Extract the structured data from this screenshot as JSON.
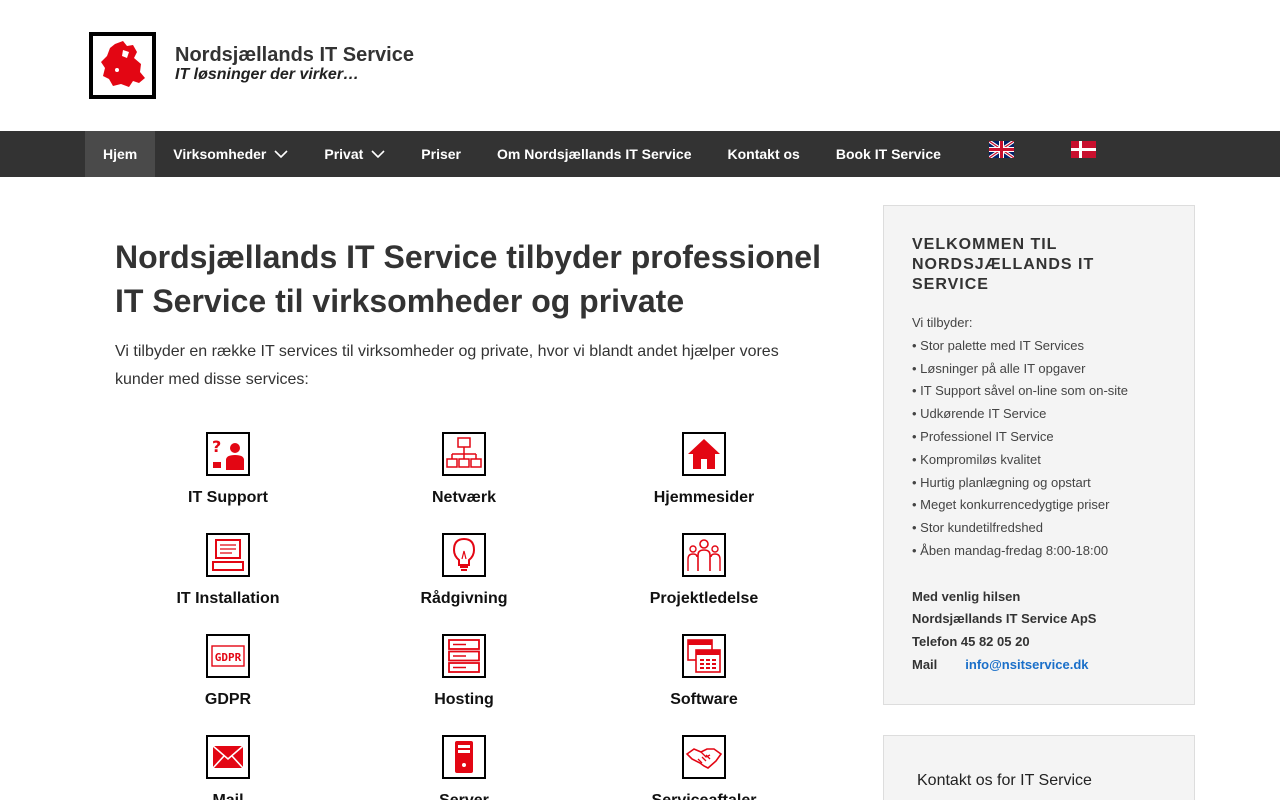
{
  "header": {
    "title": "Nordsjællands IT Service",
    "tagline": "IT løsninger der virker…"
  },
  "nav": {
    "items": [
      {
        "label": "Hjem",
        "active": true,
        "dropdown": false
      },
      {
        "label": "Virksomheder",
        "active": false,
        "dropdown": true
      },
      {
        "label": "Privat",
        "active": false,
        "dropdown": true
      },
      {
        "label": "Priser",
        "active": false,
        "dropdown": false
      },
      {
        "label": "Om Nordsjællands IT Service",
        "active": false,
        "dropdown": false
      },
      {
        "label": "Kontakt os",
        "active": false,
        "dropdown": false
      },
      {
        "label": "Book IT Service",
        "active": false,
        "dropdown": false
      }
    ],
    "flags": [
      "uk-flag-icon",
      "danish-flag-icon"
    ]
  },
  "main": {
    "title": "Nordsjællands IT Service tilbyder professionel IT Service til virksomheder og private",
    "intro": "Vi tilbyder en række IT services til virksomheder og private, hvor vi blandt andet hjælper vores kunder med disse services:"
  },
  "services": [
    {
      "label": "IT Support",
      "icon": "support-person-icon"
    },
    {
      "label": "Netværk",
      "icon": "network-icon"
    },
    {
      "label": "Hjemmesider",
      "icon": "house-icon"
    },
    {
      "label": "IT Installation",
      "icon": "computer-icon"
    },
    {
      "label": "Rådgivning",
      "icon": "lightbulb-icon"
    },
    {
      "label": "Projektledelse",
      "icon": "team-icon"
    },
    {
      "label": "GDPR",
      "icon": "gdpr-icon"
    },
    {
      "label": "Hosting",
      "icon": "server-rack-icon"
    },
    {
      "label": "Software",
      "icon": "software-window-icon"
    },
    {
      "label": "Mail",
      "icon": "mail-icon"
    },
    {
      "label": "Server",
      "icon": "server-tower-icon"
    },
    {
      "label": "Serviceaftaler",
      "icon": "handshake-icon"
    }
  ],
  "sidebar": {
    "title": "VELKOMMEN TIL NORDSJÆLLANDS IT SERVICE",
    "intro": "Vi tilbyder:",
    "list": [
      "• Stor palette med IT Services",
      "• Løsninger på alle IT opgaver",
      "• IT Support såvel on-line som on-site",
      "• Udkørende IT Service",
      "• Professionel IT Service",
      "• Kompromiløs kvalitet",
      "• Hurtig planlægning og opstart",
      "• Meget konkurrencedygtige priser",
      "• Stor kundetilfredshed",
      "• Åben mandag-fredag 8:00-18:00"
    ],
    "greeting": "Med venlig hilsen",
    "company": "Nordsjællands IT Service ApS",
    "phone": "Telefon 45 82 05 20",
    "mail_label": "Mail",
    "mail": "info@nsitservice.dk"
  },
  "sidebar2": {
    "title": "Kontakt os for IT Service"
  },
  "colors": {
    "nav_bg": "#333333",
    "nav_active": "#4a4a4a",
    "icon_red": "#e30613",
    "link": "#1a6fc9"
  }
}
